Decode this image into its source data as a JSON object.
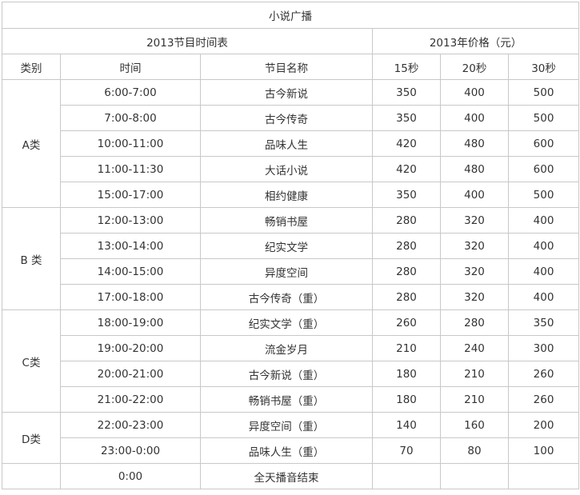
{
  "title": "小说广播",
  "schedule_header": "2013节目时间表",
  "price_header": "2013年价格（元）",
  "columns": {
    "category": "类别",
    "time": "时间",
    "program": "节目名称",
    "s15": "15秒",
    "s20": "20秒",
    "s30": "30秒"
  },
  "groups": [
    {
      "category": "A类",
      "rows": [
        {
          "time": "6:00-7:00",
          "program": "古今新说",
          "p15": "350",
          "p20": "400",
          "p30": "500"
        },
        {
          "time": "7:00-8:00",
          "program": "古今传奇",
          "p15": "350",
          "p20": "400",
          "p30": "500"
        },
        {
          "time": "10:00-11:00",
          "program": "品味人生",
          "p15": "420",
          "p20": "480",
          "p30": "600"
        },
        {
          "time": "11:00-11:30",
          "program": "大话小说",
          "p15": "420",
          "p20": "480",
          "p30": "600"
        },
        {
          "time": "15:00-17:00",
          "program": "相约健康",
          "p15": "350",
          "p20": "400",
          "p30": "500"
        }
      ]
    },
    {
      "category": "B 类",
      "rows": [
        {
          "time": "12:00-13:00",
          "program": "畅销书屋",
          "p15": "280",
          "p20": "320",
          "p30": "400"
        },
        {
          "time": "13:00-14:00",
          "program": "纪实文学",
          "p15": "280",
          "p20": "320",
          "p30": "400"
        },
        {
          "time": "14:00-15:00",
          "program": "异度空间",
          "p15": "280",
          "p20": "320",
          "p30": "400"
        },
        {
          "time": "17:00-18:00",
          "program": "古今传奇（重）",
          "p15": "280",
          "p20": "320",
          "p30": "400"
        }
      ]
    },
    {
      "category": "C类",
      "rows": [
        {
          "time": "18:00-19:00",
          "program": "纪实文学（重）",
          "p15": "260",
          "p20": "280",
          "p30": "350"
        },
        {
          "time": "19:00-20:00",
          "program": "流金岁月",
          "p15": "210",
          "p20": "240",
          "p30": "300"
        },
        {
          "time": "20:00-21:00",
          "program": "古今新说（重）",
          "p15": "180",
          "p20": "210",
          "p30": "260"
        },
        {
          "time": "21:00-22:00",
          "program": "畅销书屋（重）",
          "p15": "180",
          "p20": "210",
          "p30": "260"
        }
      ]
    },
    {
      "category": "D类",
      "rows": [
        {
          "time": "22:00-23:00",
          "program": "异度空间（重）",
          "p15": "140",
          "p20": "160",
          "p30": "200"
        },
        {
          "time": "23:00-0:00",
          "program": "品味人生（重）",
          "p15": "70",
          "p20": "80",
          "p30": "100"
        }
      ]
    }
  ],
  "end_row": {
    "category": "",
    "time": "0:00",
    "program": "全天播音结束",
    "p15": "",
    "p20": "",
    "p30": ""
  },
  "colors": {
    "border": "#c8c8c8",
    "text": "#333333"
  }
}
